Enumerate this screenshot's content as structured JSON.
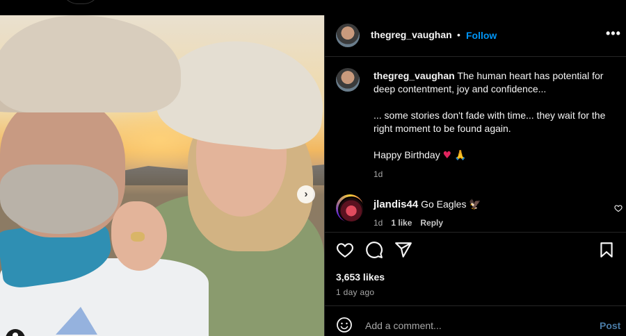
{
  "post": {
    "username": "thegreg_vaughan",
    "separator": "•",
    "follow_label": "Follow",
    "more_icon": "more-horizontal-icon",
    "more_label": "•••"
  },
  "caption": {
    "username": "thegreg_vaughan",
    "line1": "The human heart has potential for deep contentment, joy and confidence...",
    "line2": "... some stories don't fade with time... they wait for the right moment to be found again.",
    "line3": "Happy Birthday",
    "emoji1": "♥",
    "emoji2": "🙏",
    "time": "1d"
  },
  "comment": {
    "username": "jlandis44",
    "text": "Go Eagles",
    "emoji": "🦅",
    "time": "1d",
    "likes": "1 like",
    "reply_label": "Reply"
  },
  "stats": {
    "likes": "3,653 likes",
    "ago": "1 day ago"
  },
  "add_comment": {
    "placeholder": "Add a comment...",
    "post_label": "Post"
  },
  "carousel": {
    "next_label": "›",
    "total_slides": 2,
    "current_slide": 1
  },
  "colors": {
    "follow": "#0095f6",
    "post_button": "#4a7ba6",
    "background": "#000000",
    "secondary_text": "#a8a8a8"
  }
}
